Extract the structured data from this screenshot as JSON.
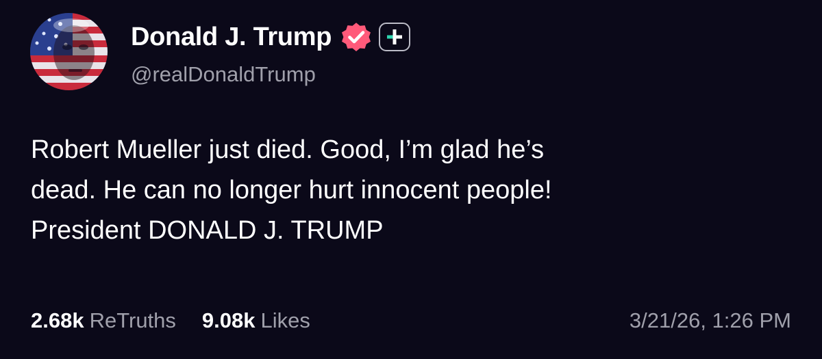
{
  "author": {
    "display_name": "Donald J. Trump",
    "handle": "@realDonaldTrump",
    "verified": true,
    "avatar": "profile-photo-flag-overlay"
  },
  "post": {
    "lines": [
      "Robert Mueller just died. Good, I’m glad he’s",
      "dead. He can no longer hurt innocent people!",
      "President DONALD J. TRUMP"
    ]
  },
  "stats": {
    "retruths_count": "2.68k",
    "retruths_label": "ReTruths",
    "likes_count": "9.08k",
    "likes_label": "Likes"
  },
  "timestamp": "3/21/26, 1:26 PM",
  "colors": {
    "background": "#0b0919",
    "text": "#ffffff",
    "muted": "#a0a0ab",
    "verified": "#ff5a7a",
    "plus_accent": "#2fd6b0"
  },
  "icons": {
    "verified": "verified-badge-icon",
    "plus": "plus-badge-icon"
  }
}
